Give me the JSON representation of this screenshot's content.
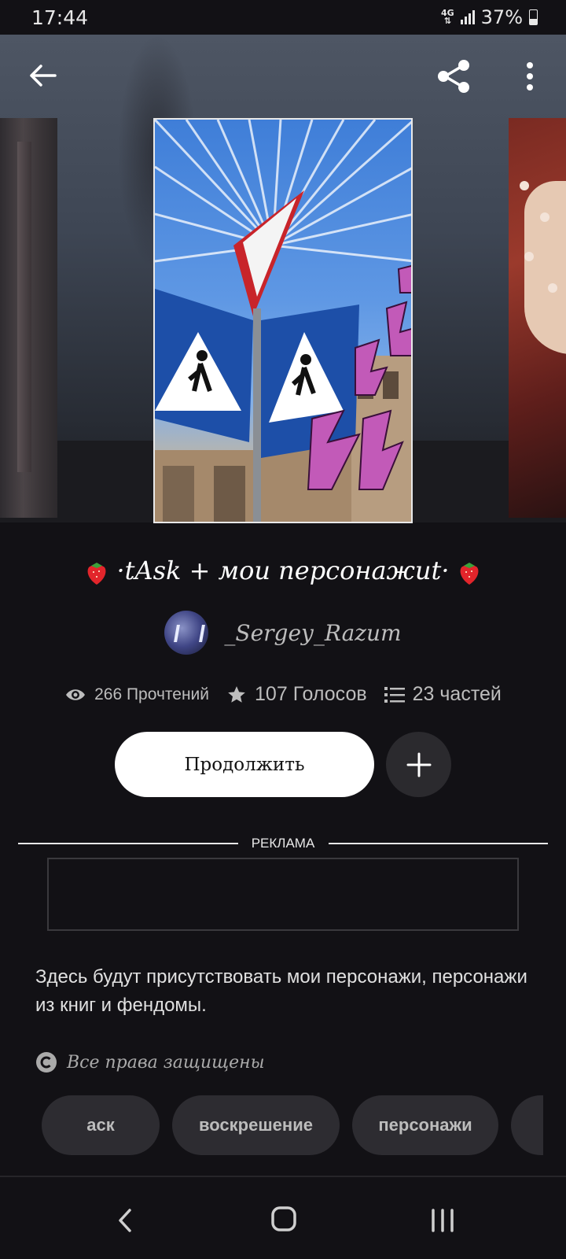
{
  "status_bar": {
    "time": "17:44",
    "network": "4G",
    "battery": "37%"
  },
  "header": {
    "back_icon": "arrow-left-icon",
    "share_icon": "share-icon",
    "menu_icon": "more-vert-icon"
  },
  "story": {
    "title": "·tAsk + мои персонажиt·",
    "author": "_Sergey_Razum",
    "reads": "266 Прочтений",
    "votes": "107 Голосов",
    "parts": "23 частей",
    "continue_label": "Продолжить",
    "ad_label": "РЕКЛАМА",
    "description": "Здесь будут присутствовать мои персонажи, персонажи из книг и фендомы.",
    "rights": "Все права защищены",
    "tags": [
      "аск",
      "воскрешение",
      "персонажи"
    ]
  },
  "colors": {
    "background": "#121115",
    "button_bg": "#ffffff",
    "tag_bg": "#2d2c31"
  }
}
